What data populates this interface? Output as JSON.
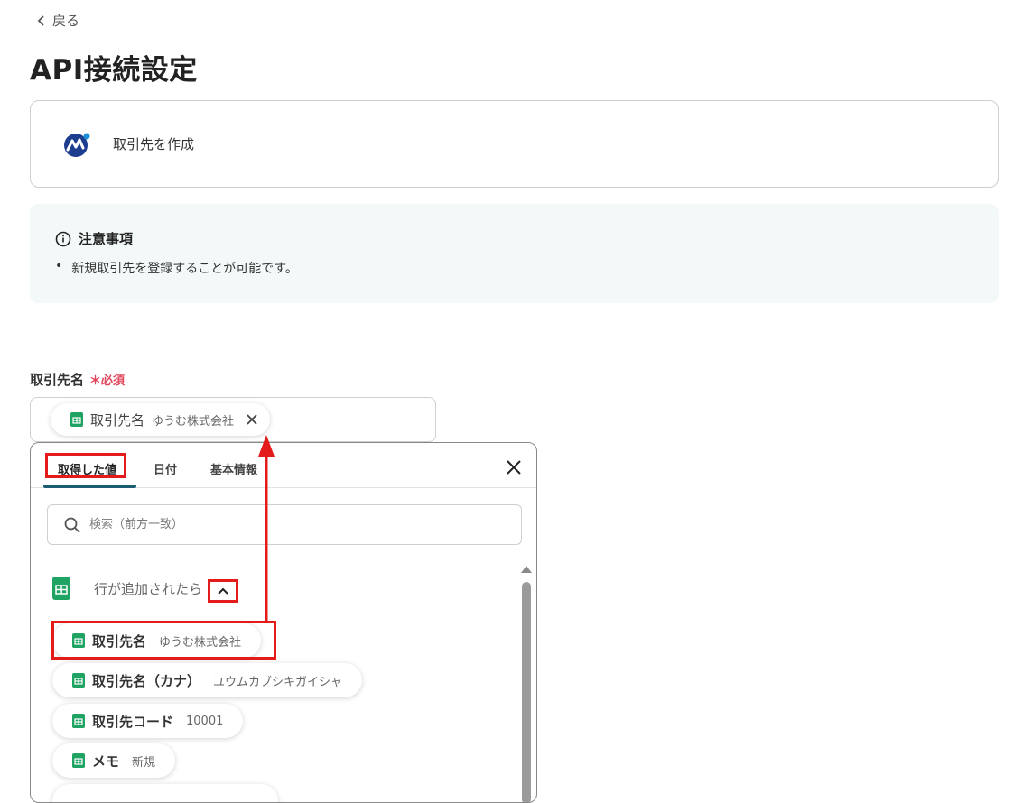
{
  "nav": {
    "back_label": "戻る"
  },
  "page": {
    "title": "API接続設定"
  },
  "action": {
    "label": "取引先を作成"
  },
  "notice": {
    "title": "注意事項",
    "items": [
      "新規取引先を登録することが可能です。"
    ]
  },
  "field": {
    "label": "取引先名",
    "required_mark": "＊",
    "required_label": "必須",
    "selected_chip": {
      "name": "取引先名",
      "value": "ゆうむ株式会社"
    }
  },
  "picker": {
    "tabs": [
      "取得した値",
      "日付",
      "基本情報"
    ],
    "active_tab": 0,
    "search_placeholder": "検索（前方一致）",
    "section_title": "行が追加されたら",
    "items": [
      {
        "name": "取引先名",
        "value": "ゆうむ株式会社"
      },
      {
        "name": "取引先名（カナ）",
        "value": "ユウムカブシキガイシャ"
      },
      {
        "name": "取引先コード",
        "value": "10001"
      },
      {
        "name": "メモ",
        "value": "新規"
      }
    ]
  },
  "colors": {
    "highlight": "#e31b1b",
    "tab_underline": "#1b5e74",
    "sheet_green": "#1ea362",
    "required": "#e0435a",
    "notice_bg": "#f2f9f8"
  }
}
